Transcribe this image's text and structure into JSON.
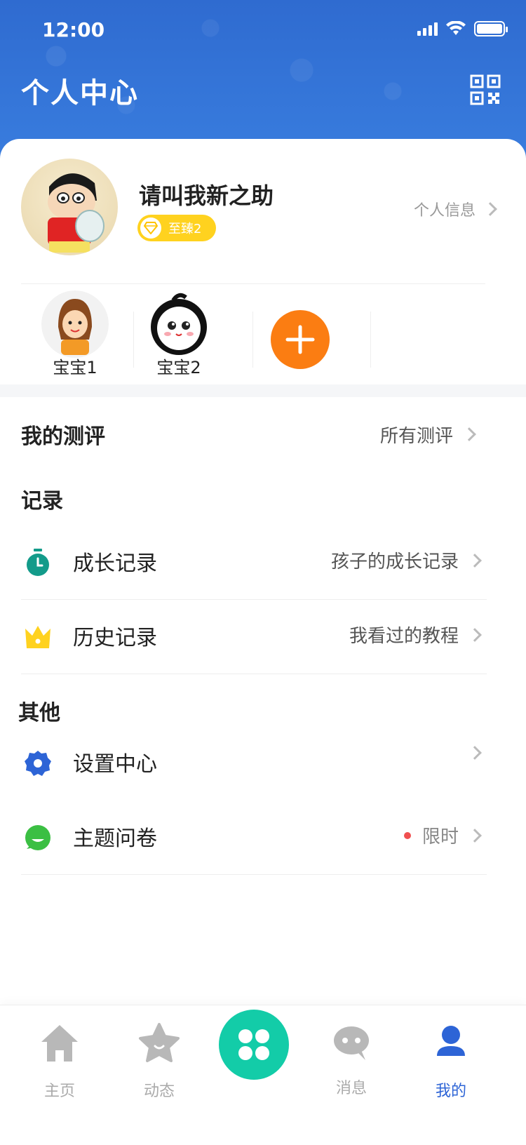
{
  "status_bar": {
    "time": "12:00"
  },
  "header": {
    "title": "个人中心"
  },
  "profile": {
    "username": "请叫我新之助",
    "vip_label": "至臻2",
    "info_link": "个人信息"
  },
  "babies": [
    {
      "name": "宝宝1"
    },
    {
      "name": "宝宝2"
    }
  ],
  "assessment": {
    "title": "我的测评",
    "link": "所有测评"
  },
  "records": {
    "title": "记录",
    "items": [
      {
        "label": "成长记录",
        "right": "孩子的成长记录",
        "icon": "stopwatch-icon",
        "color": "#139b8a"
      },
      {
        "label": "历史记录",
        "right": "我看过的教程",
        "icon": "crown-icon",
        "color": "#ffd21f"
      }
    ]
  },
  "others": {
    "title": "其他",
    "items": [
      {
        "label": "设置中心",
        "right": "",
        "icon": "gear-icon",
        "color": "#2d64d6"
      },
      {
        "label": "主题问卷",
        "right": "限时",
        "icon": "chat-icon",
        "color": "#3bbf43"
      }
    ]
  },
  "tabbar": {
    "tabs": [
      {
        "label": "主页",
        "icon": "home-icon",
        "active": false
      },
      {
        "label": "动态",
        "icon": "star-icon",
        "active": false
      },
      {
        "label": "",
        "icon": "dots-icon",
        "active": false
      },
      {
        "label": "消息",
        "icon": "message-icon",
        "active": false
      },
      {
        "label": "我的",
        "icon": "user-icon",
        "active": true
      }
    ]
  },
  "colors": {
    "primary": "#2d64d6",
    "header": "#2f6fd3",
    "orange": "#fb7d12",
    "teal": "#13cca8"
  }
}
